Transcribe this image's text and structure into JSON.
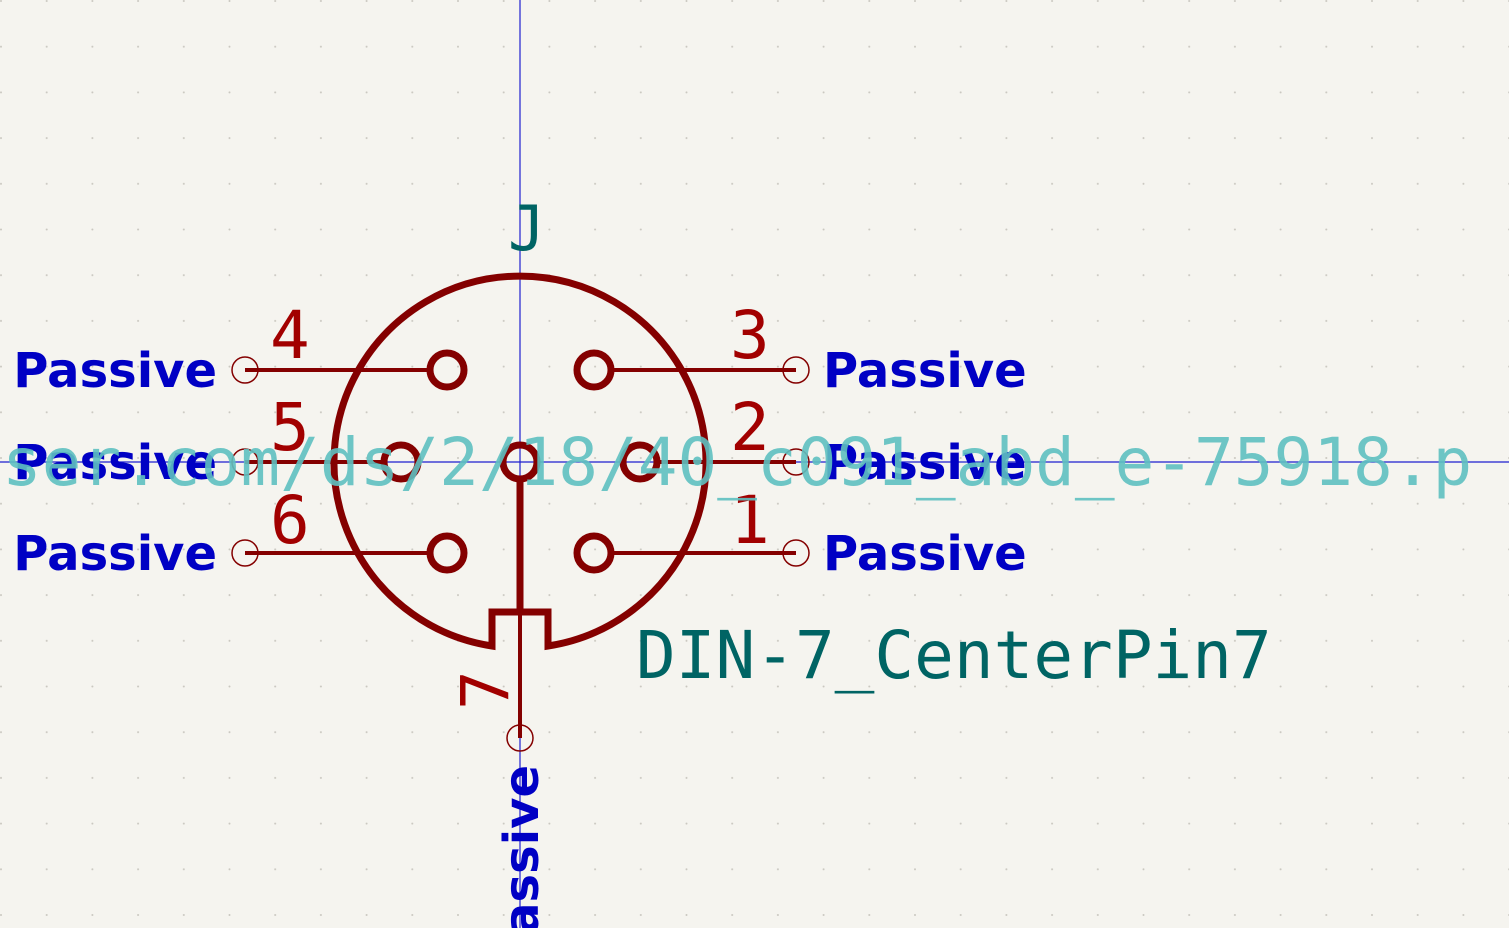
{
  "colors": {
    "background": "#f5f4ef",
    "grid_dot": "#c9c7bf",
    "symbol_body": "#840000",
    "pin_number": "#a20000",
    "electrical_type": "#0000c4",
    "reference_value": "#006464",
    "datasheet_field": "#5ec0c0",
    "axis": "#1f1fcf"
  },
  "symbol": {
    "reference": "J",
    "value": "DIN-7_CenterPin7",
    "datasheet_fragment": "ser.com/ds/2/18/40_c091_abd_e-75918.p"
  },
  "pins": [
    {
      "number": "1",
      "type": "Passive"
    },
    {
      "number": "2",
      "type": "Passive"
    },
    {
      "number": "3",
      "type": "Passive"
    },
    {
      "number": "4",
      "type": "Passive"
    },
    {
      "number": "5",
      "type": "Passive"
    },
    {
      "number": "6",
      "type": "Passive"
    },
    {
      "number": "7",
      "type": "Passive"
    }
  ]
}
